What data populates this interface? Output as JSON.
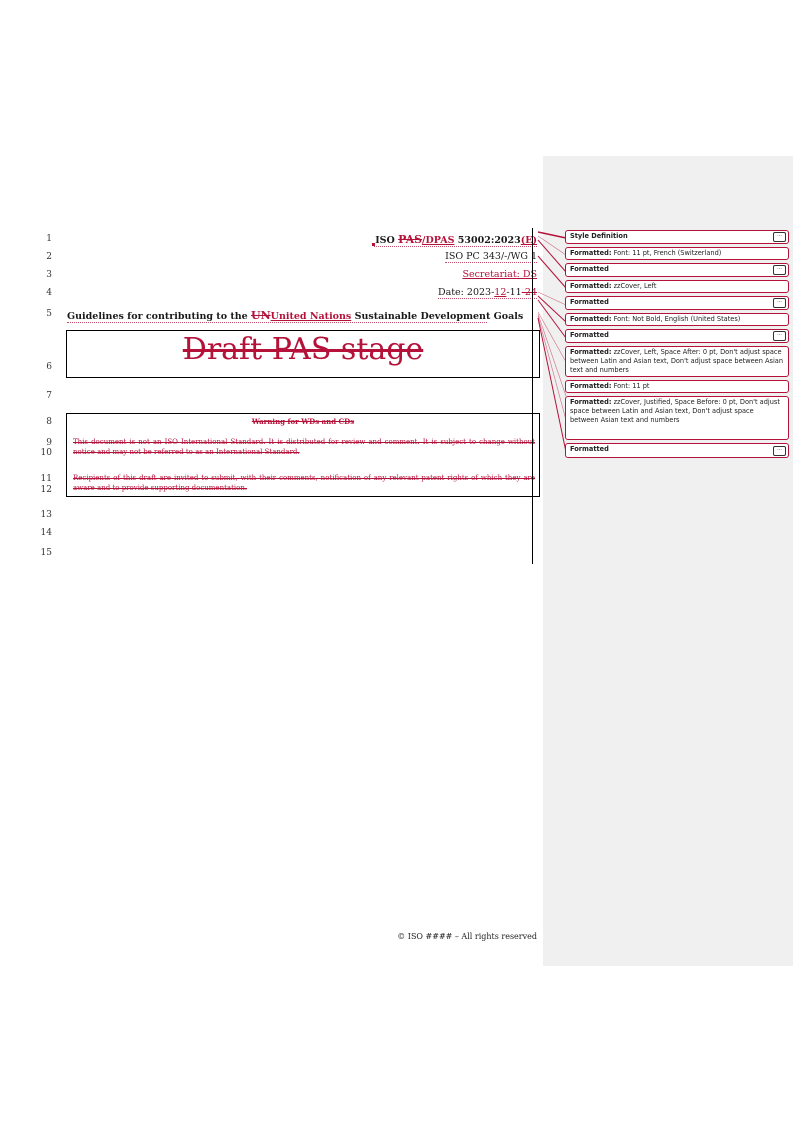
{
  "document": {
    "header_lines": {
      "line1": {
        "prefix": "ISO",
        "deleted": "PAS",
        "inserted": "/DPAS",
        "code": "53002:2023",
        "inserted_suffix": "(E)"
      },
      "line2": "ISO PC 343/-/WG 1",
      "line3": "Secretariat: DS",
      "line4": {
        "prefix": "Date: 2023-",
        "inserted": "12",
        "middle": "-11",
        "deleted": "-24"
      }
    },
    "title": {
      "prefix": "Guidelines for contributing to the ",
      "deleted": "UN",
      "inserted": "United Nations",
      "suffix": " Sustainable Development Goals"
    },
    "stage_label": "Draft PAS stage",
    "warning": {
      "title": "Warning for WDs and CDs",
      "paragraph1": "This document is not an ISO International Standard. It is distributed for review and comment. It is subject to change without notice and may not be referred to as an International Standard.",
      "paragraph2": "Recipients of this draft are invited to submit, with their comments, notification of any relevant patent rights of which they are aware and to provide supporting documentation."
    },
    "line_numbers": [
      "1",
      "2",
      "3",
      "4",
      "5",
      "6",
      "7",
      "8",
      "9",
      "10",
      "11",
      "12",
      "13",
      "14",
      "15"
    ],
    "footer": "© ISO #### – All rights reserved"
  },
  "markup_balloons": [
    {
      "label": "Style Definition",
      "detail": "",
      "has_more": true
    },
    {
      "label": "Formatted:",
      "detail": " Font: 11 pt, French (Switzerland)",
      "has_more": false
    },
    {
      "label": "Formatted",
      "detail": "",
      "has_more": true
    },
    {
      "label": "Formatted:",
      "detail": " zzCover, Left",
      "has_more": false
    },
    {
      "label": "Formatted",
      "detail": "",
      "has_more": true
    },
    {
      "label": "Formatted:",
      "detail": " Font: Not Bold, English (United States)",
      "has_more": false
    },
    {
      "label": "Formatted",
      "detail": "",
      "has_more": true
    },
    {
      "label": "Formatted:",
      "detail": " zzCover, Left, Space After:  0 pt, Don't adjust space between Latin and Asian text, Don't adjust space between Asian text and numbers",
      "has_more": false
    },
    {
      "label": "Formatted:",
      "detail": " Font: 11 pt",
      "has_more": false
    },
    {
      "label": "Formatted:",
      "detail": " zzCover, Justified, Space Before:  0 pt, Don't adjust space between Latin and Asian text, Don't adjust space between Asian text and numbers",
      "has_more": false
    },
    {
      "label": "Formatted",
      "detail": "",
      "has_more": true
    }
  ],
  "more_button_label": "...",
  "colors": {
    "revision": "#b5123a",
    "markup_pane": "#f0f0f0"
  }
}
